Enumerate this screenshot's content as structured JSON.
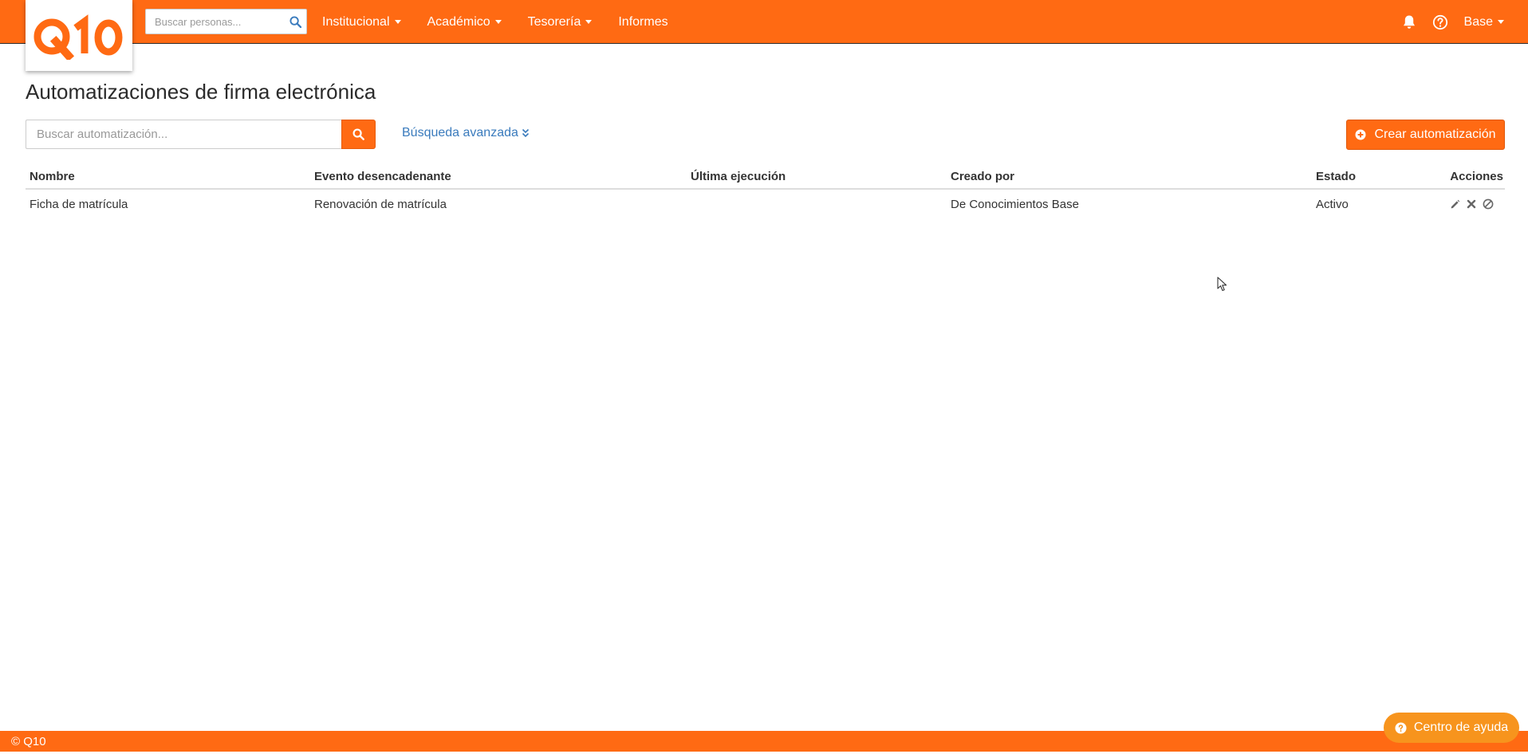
{
  "brand": {
    "logo_text": "Q10",
    "primary_color": "#ff6a13",
    "help_color": "#f7941d",
    "link_color": "#3a7bbd"
  },
  "navbar": {
    "search_placeholder": "Buscar personas...",
    "menu": [
      {
        "label": "Institucional",
        "dropdown": true
      },
      {
        "label": "Académico",
        "dropdown": true
      },
      {
        "label": "Tesorería",
        "dropdown": true
      },
      {
        "label": "Informes",
        "dropdown": false
      }
    ],
    "icons": [
      "bell-icon",
      "question-circle-icon"
    ],
    "user_label": "Base"
  },
  "page": {
    "title": "Automatizaciones de firma electrónica",
    "search_placeholder": "Buscar automatización...",
    "advanced_search_label": "Búsqueda avanzada",
    "create_button_label": "Crear automatización"
  },
  "table": {
    "headers": {
      "name": "Nombre",
      "event": "Evento desencadenante",
      "last_run": "Última ejecución",
      "created_by": "Creado por",
      "status": "Estado",
      "actions": "Acciones"
    },
    "rows": [
      {
        "name": "Ficha de matrícula",
        "event": "Renovación de matrícula",
        "last_run": "",
        "created_by": "De Conocimientos Base",
        "status": "Activo",
        "actions": [
          "pencil-icon",
          "times-icon",
          "ban-icon"
        ]
      }
    ]
  },
  "footer": {
    "copyright": "© Q10",
    "help_label": "Centro de ayuda"
  }
}
